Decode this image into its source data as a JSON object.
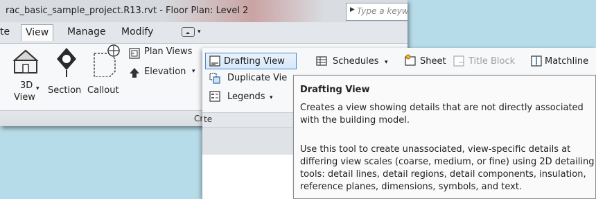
{
  "titlebar": {
    "title": "rac_basic_sample_project.R13.rvt - Floor Plan: Level 2",
    "search_placeholder": "Type a keyw"
  },
  "tabs": [
    {
      "label": "te"
    },
    {
      "label": "View"
    },
    {
      "label": "Manage"
    },
    {
      "label": "Modify"
    }
  ],
  "ribbon": {
    "three_d_view_line1": "3D",
    "three_d_view_line2": "View",
    "section": "Section",
    "callout": "Callout",
    "plan_views": "Plan Views",
    "elevation": "Elevation",
    "panel_label": "Cre"
  },
  "front_panel": {
    "drafting_view": "Drafting View",
    "duplicate_view": "Duplicate Vie",
    "legends": "Legends",
    "schedules": "Schedules",
    "sheet": "Sheet",
    "title_block": "Title Block",
    "matchline": "Matchline",
    "panel_label_fragment": "te"
  },
  "tooltip": {
    "title": "Drafting View",
    "line1": "Creates a view showing details that are not directly associated",
    "line2": "with the building model.",
    "line3": "Use this tool to create unassociated, view-specific details at",
    "line4": "differing view scales (coarse, medium, or fine) using 2D detailing",
    "line5": "tools: detail lines, detail regions, detail components, insulation,",
    "line6": "reference planes, dimensions, symbols, and text."
  }
}
